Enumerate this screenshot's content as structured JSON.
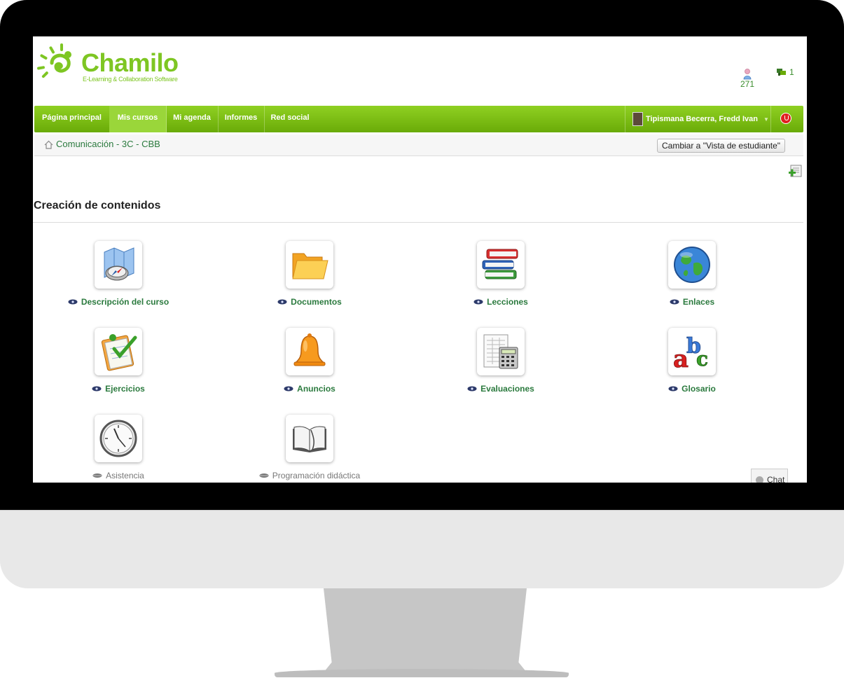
{
  "brand": {
    "name": "Chamilo",
    "tagline": "E-Learning & Collaboration Software",
    "color": "#7ec623"
  },
  "header": {
    "online_users_count": "271",
    "notifications_count": "1"
  },
  "nav": {
    "items": [
      {
        "label": "Página principal"
      },
      {
        "label": "Mis cursos",
        "active": true
      },
      {
        "label": "Mi agenda"
      },
      {
        "label": "Informes"
      },
      {
        "label": "Red social"
      }
    ],
    "user_name": "Tipismana Becerra, Fredd Ivan",
    "accent": "#7ec623"
  },
  "breadcrumb": {
    "course": "Comunicación - 3C - CBB"
  },
  "actions": {
    "student_view": "Cambiar a \"Vista de estudiante\""
  },
  "section": {
    "title": "Creación de contenidos"
  },
  "tools": [
    {
      "label": "Descripción del curso",
      "icon": "compass-map-icon",
      "visible": true
    },
    {
      "label": "Documentos",
      "icon": "folder-icon",
      "visible": true
    },
    {
      "label": "Lecciones",
      "icon": "books-icon",
      "visible": true
    },
    {
      "label": "Enlaces",
      "icon": "globe-icon",
      "visible": true
    },
    {
      "label": "Ejercicios",
      "icon": "quiz-checklist-icon",
      "visible": true
    },
    {
      "label": "Anuncios",
      "icon": "bell-icon",
      "visible": true
    },
    {
      "label": "Evaluaciones",
      "icon": "calculator-icon",
      "visible": true
    },
    {
      "label": "Glosario",
      "icon": "abc-icon",
      "visible": true
    },
    {
      "label": "Asistencia",
      "icon": "clock-icon",
      "visible": false
    },
    {
      "label": "Programación didáctica",
      "icon": "open-book-icon",
      "visible": false
    }
  ],
  "chat": {
    "label": "Chat"
  }
}
